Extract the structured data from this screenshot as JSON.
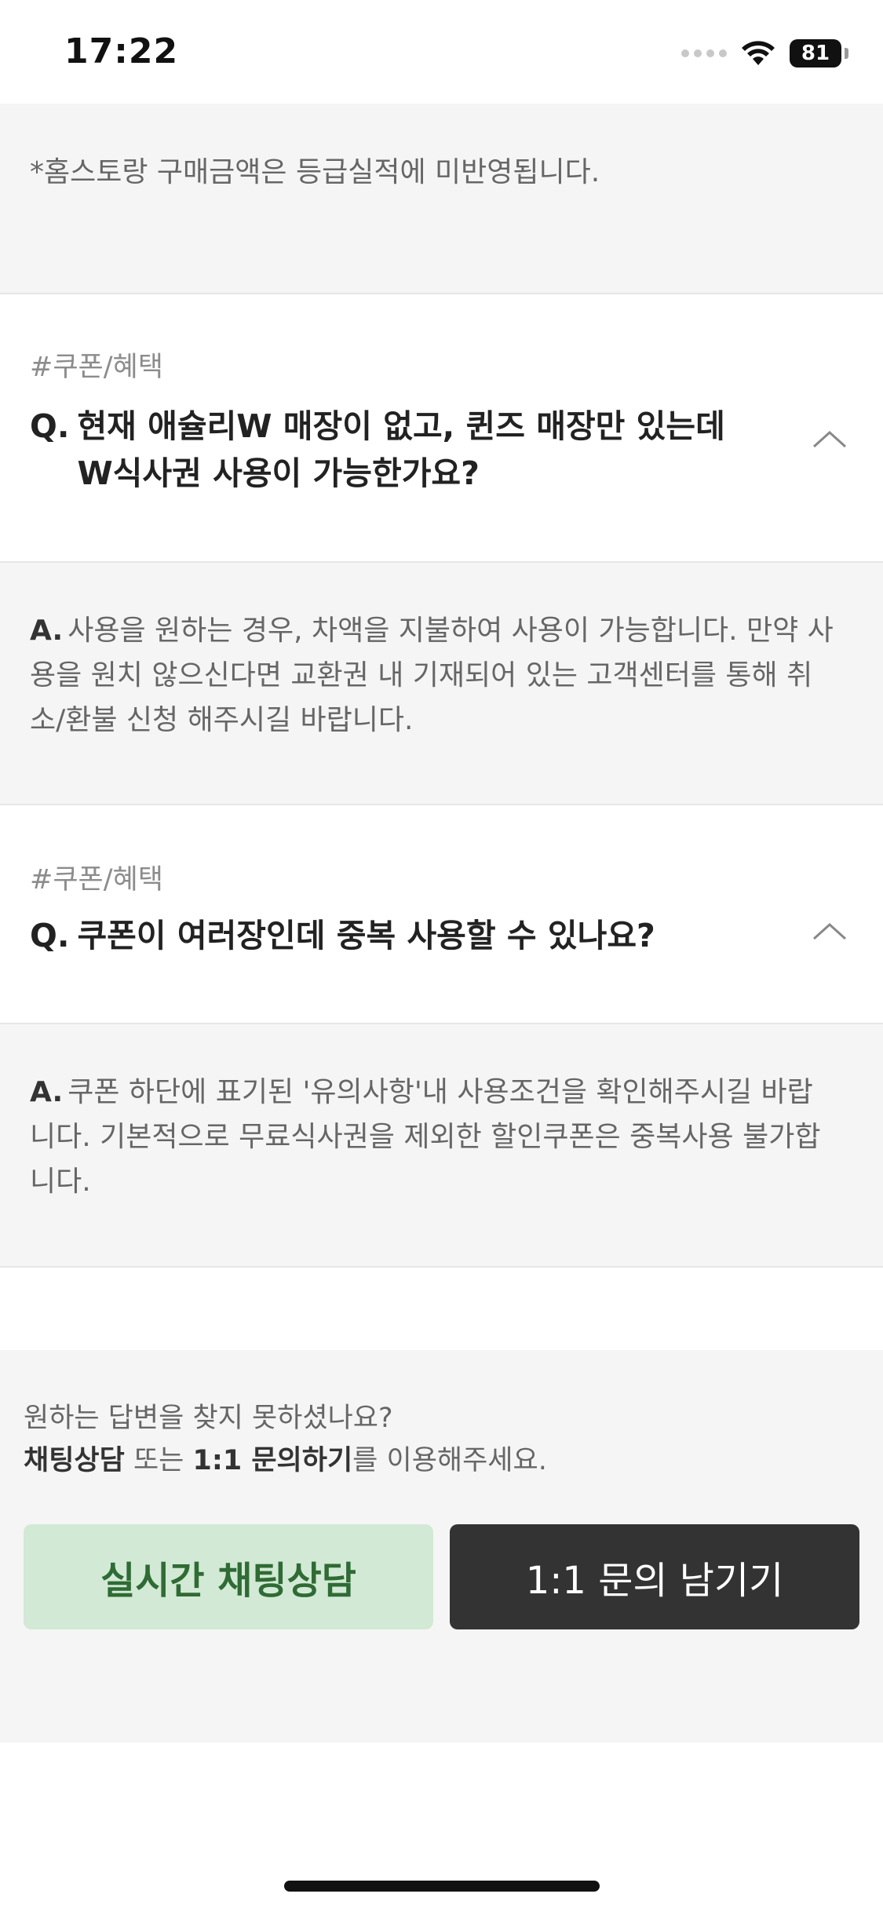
{
  "status_bar": {
    "time": "17:22",
    "battery": "81",
    "icons": [
      "signal-dots-icon",
      "wifi-icon",
      "battery-icon"
    ]
  },
  "notice": {
    "text": "*홈스토랑 구매금액은 등급실적에 미반영됩니다."
  },
  "faqs": [
    {
      "tag": "#쿠폰/혜택",
      "q_prefix": "Q.",
      "question": "현재 애슐리W 매장이 없고, 퀸즈 매장만 있는데 W식사권 사용이 가능한가요?",
      "a_prefix": "A.",
      "answer": "사용을 원하는 경우, 차액을 지불하여 사용이 가능합니다. 만약 사용을 원치 않으신다면 교환권 내 기재되어 있는 고객센터를 통해 취소/환불 신청 해주시길 바랍니다.",
      "expanded": true
    },
    {
      "tag": "#쿠폰/혜택",
      "q_prefix": "Q.",
      "question": "쿠폰이 여러장인데 중복 사용할 수 있나요?",
      "a_prefix": "A.",
      "answer": "쿠폰 하단에 표기된 '유의사항'내 사용조건을 확인해주시길 바랍니다. 기본적으로 무료식사권을 제외한 할인쿠폰은 중복사용 불가합니다.",
      "expanded": true
    }
  ],
  "help": {
    "line1": "원하는 답변을 찾지 못하셨나요?",
    "chat_bold": "채팅상담",
    "or_text": " 또는 ",
    "inquiry_bold": "1:1 문의하기",
    "suffix": "를 이용해주세요.",
    "chat_button": "실시간 채팅상담",
    "inquiry_button": "1:1 문의 남기기"
  },
  "colors": {
    "chat_button_bg": "#d2e9d5",
    "chat_button_text": "#2f6b34",
    "inquiry_button_bg": "#333333"
  }
}
